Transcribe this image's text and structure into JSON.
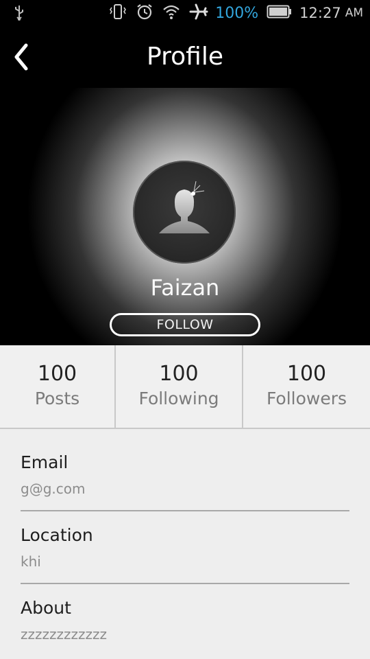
{
  "status_bar": {
    "battery_percent": "100%",
    "time": "12:27",
    "ampm": "AM",
    "icons": [
      "usb-icon",
      "vibrate-icon",
      "alarm-icon",
      "wifi-icon",
      "airplane-icon",
      "battery-icon"
    ]
  },
  "header": {
    "title": "Profile",
    "back_icon": "back-icon"
  },
  "profile": {
    "name": "Faizan",
    "follow_label": "FOLLOW",
    "avatar_icon": "user-silhouette-icon"
  },
  "stats": [
    {
      "value": "100",
      "label": "Posts"
    },
    {
      "value": "100",
      "label": "Following"
    },
    {
      "value": "100",
      "label": "Followers"
    }
  ],
  "fields": [
    {
      "label": "Email",
      "value": "g@g.com"
    },
    {
      "label": "Location",
      "value": "khi"
    },
    {
      "label": "About",
      "value": "zzzzzzzzzzzz"
    }
  ],
  "colors": {
    "accent_blue": "#33a6dd",
    "stats_bg": "#f0f0f0",
    "details_bg": "#eeeeee"
  }
}
